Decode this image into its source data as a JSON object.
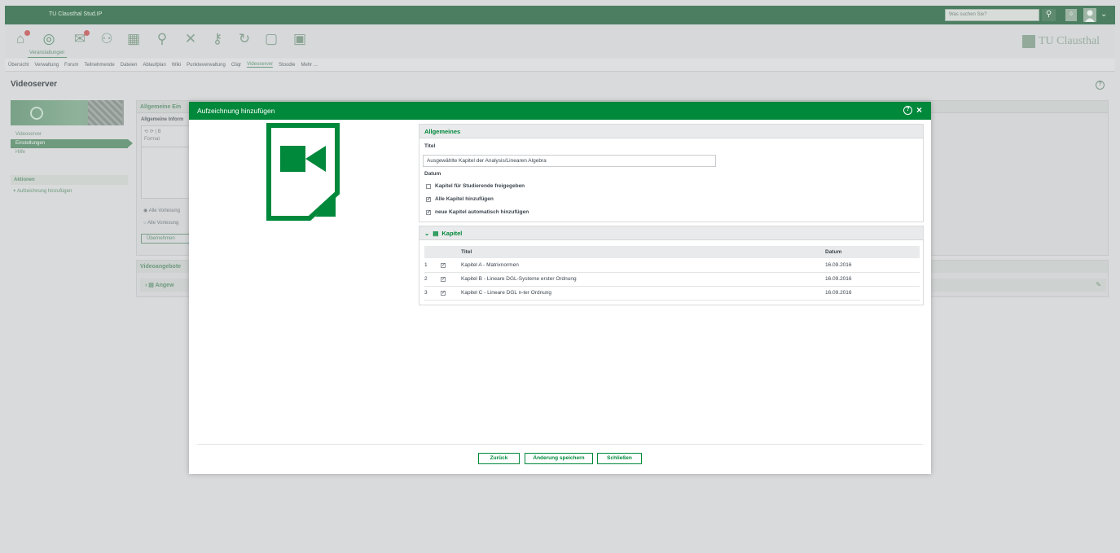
{
  "topbar": {
    "brand": "TU Clausthal Stud.IP",
    "search_placeholder": "Was suchen Sie?",
    "search_icon": "magnifier-icon",
    "notifications_count": "0",
    "colors": {
      "bar": "#4c7f61",
      "accent": "#00883b"
    }
  },
  "iconnav": {
    "items": [
      "home-icon",
      "courses-icon",
      "messages-icon",
      "community-icon",
      "calendar-icon",
      "search-icon",
      "tools-icon",
      "key-icon",
      "refresh-icon",
      "file-icon",
      "image-icon"
    ],
    "active_label": "Veranstaltungen",
    "logo_text": "TU Clausthal"
  },
  "tabs": {
    "items": [
      "Übersicht",
      "Verwaltung",
      "Forum",
      "Teilnehmende",
      "Dateien",
      "Ablaufplan",
      "Wiki",
      "Punkteverwaltung",
      "Cliqr",
      "Videoserver",
      "Stoodle",
      "Mehr ..."
    ],
    "active": "Videoserver"
  },
  "page": {
    "title": "Videoserver"
  },
  "sidebar": {
    "nav": [
      "Videoserver",
      "Einstellungen",
      "Hilfe"
    ],
    "active": "Einstellungen",
    "actions_heading": "Aktionen",
    "action": "Aufzeichnung hinzufügen"
  },
  "background": {
    "panel1_heading": "Allgemeine Ein",
    "panel1_sub": "Allgemeine Inform",
    "editor_toolbar": "⟲ ⟳ | B",
    "editor_format": "Format",
    "radio1": "Alle Vorlesung",
    "radio2": "Alle Vorlesung",
    "apply_button": "Übernehmen",
    "panel2_heading": "Videoangebote",
    "panel2_row": "Angew"
  },
  "modal": {
    "title": "Aufzeichnung hinzufügen",
    "general": {
      "heading": "Allgemeines",
      "title_label": "Titel",
      "title_value": "Ausgewählte Kapitel der Analysis/Linearen Algebra",
      "date_label": "Datum",
      "checkboxes": [
        {
          "label": "Kapitel für Studierende freigegeben",
          "checked": false
        },
        {
          "label": "Alle Kapitel hinzufügen",
          "checked": true
        },
        {
          "label": "neue Kapitel automatisch hinzufügen",
          "checked": true
        }
      ]
    },
    "chapters": {
      "heading": "Kapitel",
      "columns": [
        "Titel",
        "Datum"
      ],
      "rows": [
        {
          "num": "1",
          "checked": true,
          "title": "Kapitel A - Matrixnormen",
          "date": "16.09.2016"
        },
        {
          "num": "2",
          "checked": true,
          "title": "Kapitel B - Lineare DGL-Systeme erster Ordnung",
          "date": "16.09.2016"
        },
        {
          "num": "3",
          "checked": true,
          "title": "Kapitel C - Lineare DGL n-ter Ordnung",
          "date": "16.09.2016"
        }
      ]
    },
    "buttons": {
      "back": "Zurück",
      "save": "Änderung speichern",
      "close": "Schließen"
    }
  }
}
